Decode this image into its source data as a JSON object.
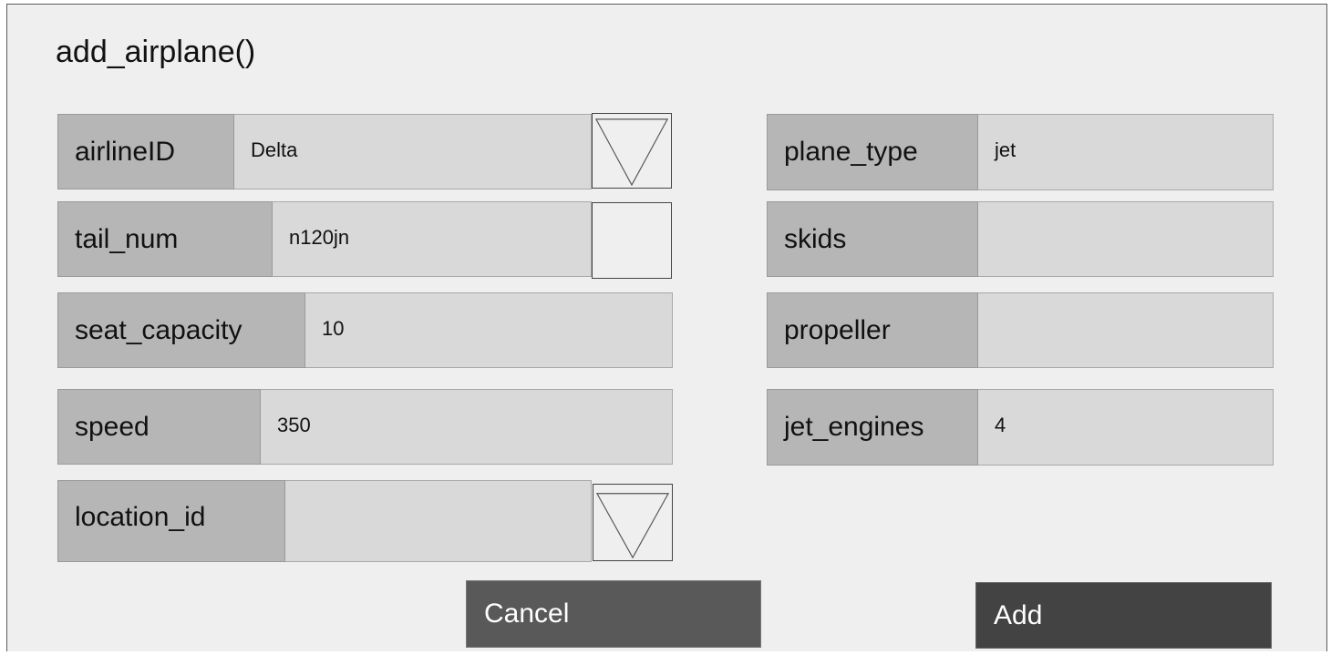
{
  "title": "add_airplane()",
  "left_fields": {
    "airline_id": {
      "label": "airlineID",
      "value": "Delta",
      "control": "chevron-down-icon"
    },
    "tail_num": {
      "label": "tail_num",
      "value": "n120jn",
      "control": "checkbox"
    },
    "seat_capacity": {
      "label": "seat_capacity",
      "value": "10"
    },
    "speed": {
      "label": "speed",
      "value": "350"
    },
    "location_id": {
      "label": "location_id",
      "value": "",
      "control": "chevron-down-icon"
    }
  },
  "right_fields": {
    "plane_type": {
      "label": "plane_type",
      "value": "jet"
    },
    "skids": {
      "label": "skids",
      "value": ""
    },
    "propeller": {
      "label": "propeller",
      "value": ""
    },
    "jet_engines": {
      "label": "jet_engines",
      "value": "4"
    }
  },
  "buttons": {
    "cancel": "Cancel",
    "add": "Add"
  },
  "colors": {
    "background": "#efefef",
    "label_bg": "#b6b6b6",
    "field_bg": "#d9d9d9",
    "cancel_bg": "#595959",
    "add_bg": "#434343"
  }
}
